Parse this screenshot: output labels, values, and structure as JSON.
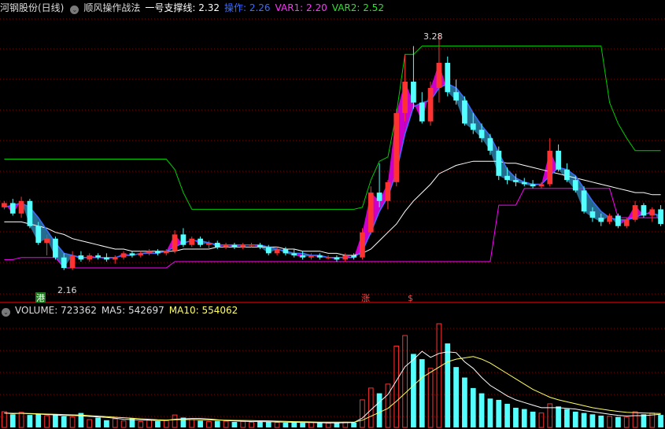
{
  "header": {
    "stock": "河钢股份(日线)",
    "indicator": "顺风操作战法",
    "support_label": "一号支撑线: 2.32",
    "op_label": "操作: 2.26",
    "var1_label": "VAR1: 2.20",
    "var2_label": "VAR2: 2.52"
  },
  "vol_header": {
    "volume_label": "VOLUME: 723362",
    "ma5_label": "MA5: 542697",
    "ma10_label": "MA10: 554062"
  },
  "annotations": {
    "high_label": "3.28",
    "low_label": "2.16",
    "badge_gang": "港",
    "badge_zhang": "涨",
    "badge_dollar": "$"
  },
  "colors": {
    "up": "#ff3232",
    "down": "#54ffff",
    "op": "#3a6cff",
    "var1": "#ff00ff",
    "var2": "#00cc00",
    "ma": "#ffffff",
    "vol_ma5": "#ffffff",
    "vol_ma10": "#ffff66",
    "grid": "#8b0000",
    "band": "#ee00ee",
    "band_down": "#2a7fa8"
  },
  "chart_data": {
    "type": "candlestick",
    "price_range": [
      2.1,
      3.35
    ],
    "volume_range": [
      0,
      850000
    ],
    "candles": [
      [
        2.45,
        2.48,
        2.44,
        2.47
      ],
      [
        2.47,
        2.49,
        2.41,
        2.42
      ],
      [
        2.42,
        2.5,
        2.4,
        2.48
      ],
      [
        2.48,
        2.49,
        2.35,
        2.36
      ],
      [
        2.36,
        2.38,
        2.27,
        2.28
      ],
      [
        2.28,
        2.32,
        2.22,
        2.3
      ],
      [
        2.3,
        2.31,
        2.2,
        2.21
      ],
      [
        2.21,
        2.23,
        2.15,
        2.16
      ],
      [
        2.16,
        2.24,
        2.15,
        2.22
      ],
      [
        2.22,
        2.24,
        2.19,
        2.2
      ],
      [
        2.2,
        2.23,
        2.19,
        2.22
      ],
      [
        2.22,
        2.23,
        2.2,
        2.21
      ],
      [
        2.21,
        2.23,
        2.19,
        2.2
      ],
      [
        2.2,
        2.22,
        2.18,
        2.21
      ],
      [
        2.21,
        2.24,
        2.2,
        2.23
      ],
      [
        2.23,
        2.24,
        2.21,
        2.22
      ],
      [
        2.22,
        2.24,
        2.21,
        2.23
      ],
      [
        2.23,
        2.25,
        2.22,
        2.24
      ],
      [
        2.24,
        2.25,
        2.22,
        2.23
      ],
      [
        2.23,
        2.25,
        2.22,
        2.24
      ],
      [
        2.24,
        2.34,
        2.23,
        2.32
      ],
      [
        2.32,
        2.35,
        2.26,
        2.27
      ],
      [
        2.27,
        2.31,
        2.26,
        2.3
      ],
      [
        2.3,
        2.31,
        2.26,
        2.27
      ],
      [
        2.27,
        2.29,
        2.25,
        2.28
      ],
      [
        2.28,
        2.29,
        2.25,
        2.26
      ],
      [
        2.26,
        2.28,
        2.25,
        2.27
      ],
      [
        2.27,
        2.28,
        2.25,
        2.26
      ],
      [
        2.26,
        2.28,
        2.25,
        2.27
      ],
      [
        2.27,
        2.28,
        2.26,
        2.27
      ],
      [
        2.27,
        2.28,
        2.25,
        2.26
      ],
      [
        2.26,
        2.27,
        2.22,
        2.23
      ],
      [
        2.23,
        2.26,
        2.22,
        2.25
      ],
      [
        2.25,
        2.26,
        2.22,
        2.23
      ],
      [
        2.23,
        2.25,
        2.21,
        2.22
      ],
      [
        2.22,
        2.24,
        2.2,
        2.21
      ],
      [
        2.21,
        2.23,
        2.2,
        2.22
      ],
      [
        2.22,
        2.23,
        2.2,
        2.21
      ],
      [
        2.21,
        2.22,
        2.2,
        2.21
      ],
      [
        2.21,
        2.22,
        2.19,
        2.2
      ],
      [
        2.2,
        2.23,
        2.19,
        2.22
      ],
      [
        2.22,
        2.23,
        2.2,
        2.21
      ],
      [
        2.21,
        2.35,
        2.2,
        2.33
      ],
      [
        2.33,
        2.55,
        2.32,
        2.52
      ],
      [
        2.52,
        2.66,
        2.45,
        2.48
      ],
      [
        2.48,
        2.58,
        2.44,
        2.57
      ],
      [
        2.57,
        2.92,
        2.55,
        2.9
      ],
      [
        2.9,
        3.18,
        2.86,
        3.05
      ],
      [
        3.05,
        3.22,
        2.92,
        2.95
      ],
      [
        2.95,
        3.0,
        2.85,
        2.86
      ],
      [
        2.86,
        3.05,
        2.84,
        3.02
      ],
      [
        3.02,
        3.28,
        2.95,
        3.14
      ],
      [
        3.14,
        3.17,
        2.98,
        3.0
      ],
      [
        3.0,
        3.06,
        2.94,
        2.96
      ],
      [
        2.96,
        2.98,
        2.84,
        2.85
      ],
      [
        2.85,
        2.9,
        2.8,
        2.82
      ],
      [
        2.82,
        2.85,
        2.76,
        2.78
      ],
      [
        2.78,
        2.8,
        2.7,
        2.72
      ],
      [
        2.72,
        2.74,
        2.58,
        2.6
      ],
      [
        2.6,
        2.64,
        2.56,
        2.58
      ],
      [
        2.58,
        2.61,
        2.55,
        2.57
      ],
      [
        2.57,
        2.59,
        2.55,
        2.56
      ],
      [
        2.56,
        2.58,
        2.54,
        2.55
      ],
      [
        2.55,
        2.57,
        2.54,
        2.56
      ],
      [
        2.56,
        2.78,
        2.55,
        2.72
      ],
      [
        2.72,
        2.75,
        2.62,
        2.63
      ],
      [
        2.63,
        2.66,
        2.57,
        2.58
      ],
      [
        2.58,
        2.6,
        2.52,
        2.53
      ],
      [
        2.53,
        2.55,
        2.42,
        2.43
      ],
      [
        2.43,
        2.45,
        2.38,
        2.4
      ],
      [
        2.4,
        2.42,
        2.36,
        2.38
      ],
      [
        2.38,
        2.42,
        2.37,
        2.41
      ],
      [
        2.41,
        2.42,
        2.35,
        2.36
      ],
      [
        2.36,
        2.4,
        2.35,
        2.39
      ],
      [
        2.39,
        2.48,
        2.38,
        2.46
      ],
      [
        2.46,
        2.47,
        2.4,
        2.41
      ],
      [
        2.41,
        2.45,
        2.38,
        2.44
      ],
      [
        2.44,
        2.46,
        2.36,
        2.37
      ]
    ],
    "ma": [
      2.38,
      2.38,
      2.38,
      2.37,
      2.36,
      2.35,
      2.33,
      2.32,
      2.3,
      2.29,
      2.28,
      2.27,
      2.26,
      2.25,
      2.25,
      2.24,
      2.24,
      2.24,
      2.24,
      2.24,
      2.24,
      2.25,
      2.25,
      2.25,
      2.25,
      2.26,
      2.26,
      2.26,
      2.26,
      2.26,
      2.26,
      2.26,
      2.26,
      2.25,
      2.25,
      2.24,
      2.24,
      2.24,
      2.23,
      2.23,
      2.22,
      2.22,
      2.23,
      2.25,
      2.29,
      2.33,
      2.37,
      2.43,
      2.48,
      2.52,
      2.56,
      2.61,
      2.63,
      2.65,
      2.66,
      2.67,
      2.67,
      2.67,
      2.67,
      2.66,
      2.66,
      2.65,
      2.64,
      2.63,
      2.62,
      2.61,
      2.6,
      2.59,
      2.58,
      2.57,
      2.56,
      2.55,
      2.54,
      2.53,
      2.52,
      2.52,
      2.51,
      2.51
    ],
    "op": [
      2.45,
      2.46,
      2.47,
      2.45,
      2.4,
      2.34,
      2.28,
      2.23,
      2.22,
      2.21,
      2.21,
      2.21,
      2.21,
      2.21,
      2.22,
      2.22,
      2.23,
      2.23,
      2.23,
      2.24,
      2.26,
      2.28,
      2.29,
      2.29,
      2.28,
      2.27,
      2.27,
      2.27,
      2.27,
      2.27,
      2.27,
      2.26,
      2.25,
      2.24,
      2.23,
      2.23,
      2.22,
      2.22,
      2.21,
      2.21,
      2.21,
      2.21,
      2.24,
      2.33,
      2.43,
      2.5,
      2.62,
      2.8,
      2.93,
      2.95,
      2.96,
      3.02,
      3.04,
      3.02,
      2.97,
      2.9,
      2.84,
      2.79,
      2.71,
      2.63,
      2.59,
      2.57,
      2.56,
      2.56,
      2.6,
      2.64,
      2.63,
      2.6,
      2.54,
      2.48,
      2.43,
      2.4,
      2.39,
      2.39,
      2.4,
      2.42,
      2.42,
      2.41
    ],
    "var1": [
      2.2,
      2.2,
      2.21,
      2.21,
      2.21,
      2.21,
      2.21,
      2.16,
      2.16,
      2.16,
      2.16,
      2.16,
      2.16,
      2.16,
      2.16,
      2.16,
      2.16,
      2.16,
      2.16,
      2.16,
      2.19,
      2.19,
      2.19,
      2.19,
      2.19,
      2.19,
      2.19,
      2.19,
      2.19,
      2.19,
      2.19,
      2.19,
      2.19,
      2.19,
      2.19,
      2.19,
      2.19,
      2.19,
      2.19,
      2.19,
      2.19,
      2.19,
      2.19,
      2.19,
      2.19,
      2.19,
      2.19,
      2.19,
      2.19,
      2.19,
      2.19,
      2.19,
      2.19,
      2.19,
      2.19,
      2.19,
      2.19,
      2.19,
      2.46,
      2.46,
      2.46,
      2.54,
      2.54,
      2.54,
      2.54,
      2.54,
      2.54,
      2.54,
      2.54,
      2.54,
      2.54,
      2.54,
      2.4,
      2.4,
      2.4,
      2.4,
      2.4,
      2.4
    ],
    "var2": [
      2.68,
      2.68,
      2.68,
      2.68,
      2.68,
      2.68,
      2.68,
      2.68,
      2.68,
      2.68,
      2.68,
      2.68,
      2.68,
      2.68,
      2.68,
      2.68,
      2.68,
      2.68,
      2.68,
      2.68,
      2.63,
      2.52,
      2.44,
      2.44,
      2.44,
      2.44,
      2.44,
      2.44,
      2.44,
      2.44,
      2.44,
      2.44,
      2.44,
      2.44,
      2.44,
      2.44,
      2.44,
      2.44,
      2.44,
      2.44,
      2.44,
      2.44,
      2.45,
      2.58,
      2.67,
      2.69,
      2.9,
      3.18,
      3.18,
      3.22,
      3.22,
      3.22,
      3.22,
      3.22,
      3.22,
      3.22,
      3.22,
      3.22,
      3.22,
      3.22,
      3.22,
      3.22,
      3.22,
      3.22,
      3.22,
      3.22,
      3.22,
      3.22,
      3.22,
      3.22,
      3.22,
      2.95,
      2.85,
      2.78,
      2.72,
      2.72,
      2.72,
      2.72
    ],
    "volume": [
      120000,
      100000,
      115000,
      95000,
      105000,
      90000,
      100000,
      85000,
      80000,
      110000,
      60000,
      75000,
      55000,
      65000,
      50000,
      70000,
      45000,
      55000,
      48000,
      52000,
      95000,
      75000,
      60000,
      52000,
      45000,
      50000,
      48000,
      42000,
      46000,
      40000,
      44000,
      42000,
      38000,
      36000,
      40000,
      35000,
      38000,
      34000,
      32000,
      36000,
      40000,
      38000,
      210000,
      300000,
      260000,
      330000,
      620000,
      700000,
      560000,
      520000,
      450000,
      790000,
      640000,
      460000,
      380000,
      300000,
      260000,
      220000,
      210000,
      180000,
      150000,
      140000,
      120000,
      110000,
      180000,
      160000,
      140000,
      120000,
      110000,
      100000,
      90000,
      85000,
      80000,
      78000,
      120000,
      100000,
      110000,
      95000
    ],
    "vol_ma5": [
      110000,
      105000,
      108000,
      104000,
      102000,
      98000,
      96000,
      90000,
      92000,
      88000,
      84000,
      80000,
      76000,
      70000,
      62000,
      60000,
      57000,
      55000,
      53000,
      54000,
      62000,
      65000,
      68000,
      68000,
      64000,
      58000,
      52000,
      49000,
      47000,
      45000,
      44000,
      43000,
      42000,
      40000,
      39000,
      38000,
      37000,
      36000,
      35000,
      35000,
      36000,
      37000,
      71000,
      134000,
      193000,
      251000,
      357000,
      462000,
      518000,
      580000,
      534000,
      564000,
      576000,
      570000,
      500000,
      450000,
      380000,
      320000,
      280000,
      240000,
      210000,
      190000,
      170000,
      150000,
      150000,
      150000,
      145000,
      140000,
      128000,
      120000,
      110000,
      100000,
      92000,
      87000,
      90000,
      90000,
      95000,
      100000
    ],
    "vol_ma10": [
      110000,
      108000,
      108000,
      106000,
      104000,
      102000,
      100000,
      98000,
      96000,
      94000,
      90000,
      86000,
      82000,
      78000,
      74000,
      70000,
      66000,
      62000,
      58000,
      56000,
      58000,
      60000,
      60000,
      59000,
      57000,
      56000,
      55000,
      54000,
      53000,
      52000,
      51000,
      50000,
      48000,
      46000,
      44000,
      43000,
      42000,
      41000,
      40000,
      40000,
      40000,
      40000,
      55000,
      85000,
      115000,
      145000,
      200000,
      260000,
      320000,
      380000,
      420000,
      460000,
      500000,
      520000,
      530000,
      540000,
      520000,
      490000,
      450000,
      410000,
      370000,
      330000,
      290000,
      260000,
      230000,
      210000,
      195000,
      180000,
      165000,
      150000,
      140000,
      130000,
      122000,
      115000,
      112000,
      110000,
      108000,
      106000
    ]
  }
}
